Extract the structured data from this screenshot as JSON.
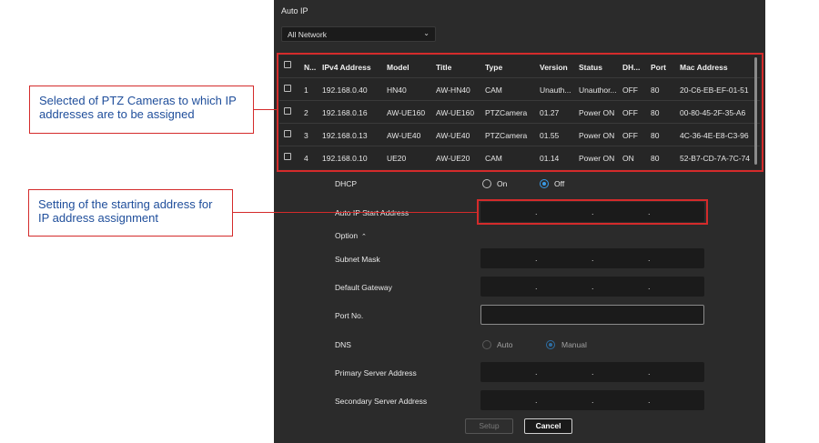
{
  "dialog": {
    "title": "Auto IP",
    "network_select": "All Network",
    "table": {
      "headers": [
        "N...",
        "IPv4 Address",
        "Model",
        "Title",
        "Type",
        "Version",
        "Status",
        "DH...",
        "Port",
        "Mac Address"
      ],
      "rows": [
        [
          "1",
          "192.168.0.40",
          "HN40",
          "AW-HN40",
          "CAM",
          "Unauth...",
          "Unauthor...",
          "OFF",
          "80",
          "20-C6-EB-EF-01-51"
        ],
        [
          "2",
          "192.168.0.16",
          "AW-UE160",
          "AW-UE160",
          "PTZCamera",
          "01.27",
          "Power ON",
          "OFF",
          "80",
          "00-80-45-2F-35-A6"
        ],
        [
          "3",
          "192.168.0.13",
          "AW-UE40",
          "AW-UE40",
          "PTZCamera",
          "01.55",
          "Power ON",
          "OFF",
          "80",
          "4C-36-4E-E8-C3-96"
        ],
        [
          "4",
          "192.168.0.10",
          "UE20",
          "AW-UE20",
          "CAM",
          "01.14",
          "Power ON",
          "ON",
          "80",
          "52-B7-CD-7A-7C-74"
        ]
      ]
    },
    "form": {
      "dhcp_label": "DHCP",
      "dhcp_on": "On",
      "dhcp_off": "Off",
      "start_address_label": "Auto IP Start Address",
      "option_label": "Option",
      "subnet_label": "Subnet Mask",
      "gateway_label": "Default Gateway",
      "port_label": "Port No.",
      "dns_label": "DNS",
      "dns_auto": "Auto",
      "dns_manual": "Manual",
      "primary_dns_label": "Primary Server Address",
      "secondary_dns_label": "Secondary Server Address",
      "ip_separator": "."
    },
    "buttons": {
      "setup": "Setup",
      "cancel": "Cancel"
    }
  },
  "callouts": {
    "cameras": "Selected of PTZ Cameras to which IP addresses are to be assigned",
    "start_address": "Setting of the starting address for IP address assignment"
  },
  "colors": {
    "accent": "#3b9be6",
    "highlight": "#d42b2b",
    "callout_text": "#1f4e9b",
    "dialog_bg": "#2b2b2b"
  }
}
